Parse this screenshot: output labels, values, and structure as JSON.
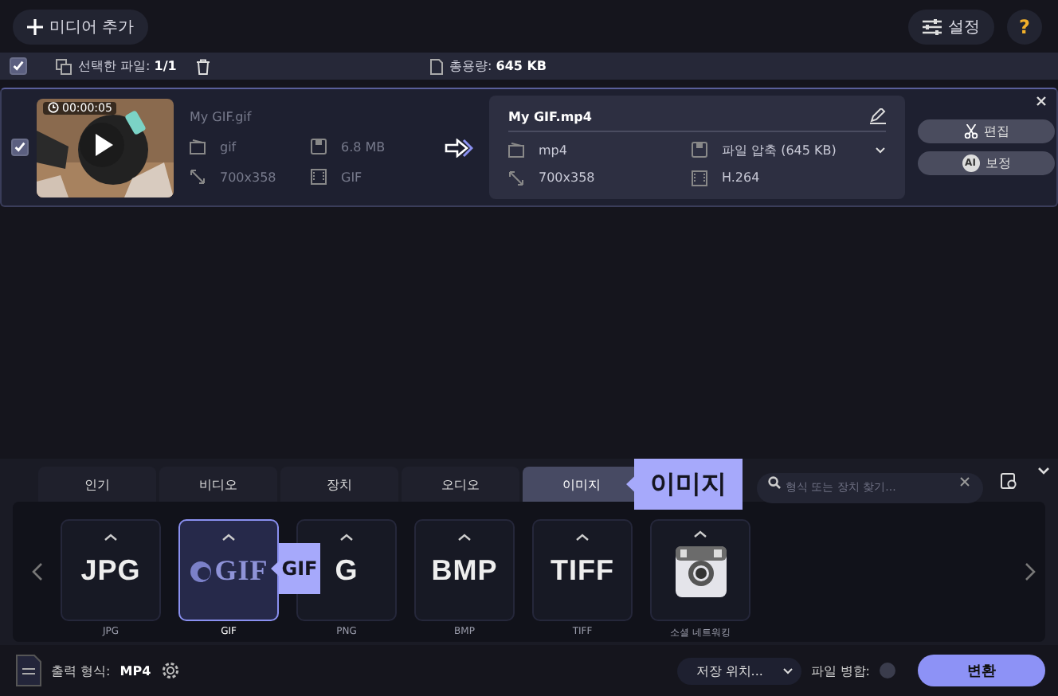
{
  "toolbar": {
    "add_media": "미디어 추가",
    "settings": "설정",
    "help": "?"
  },
  "selection_bar": {
    "checked": true,
    "selected_files_label": "선택한 파일:",
    "selected_files_count": "1/1",
    "total_size_label": "총용량:",
    "total_size": "645 KB"
  },
  "files": [
    {
      "checked": true,
      "duration": "00:00:05",
      "source": {
        "name": "My GIF.gif",
        "format": "gif",
        "size": "6.8 MB",
        "resolution": "700x358",
        "codec": "GIF"
      },
      "output": {
        "name": "My GIF.mp4",
        "format": "mp4",
        "compression": "파일 압축 (645 KB)",
        "resolution": "700x358",
        "codec": "H.264"
      },
      "edit_button": "편집",
      "enhance_badge": "AI",
      "enhance_button": "보정"
    }
  ],
  "format_tabs": [
    {
      "label": "인기",
      "selected": false
    },
    {
      "label": "비디오",
      "selected": false
    },
    {
      "label": "장치",
      "selected": false
    },
    {
      "label": "오디오",
      "selected": false
    },
    {
      "label": "이미지",
      "selected": true
    }
  ],
  "tab_tooltip": "이미지",
  "search": {
    "placeholder": "형식 또는 장치 찾기..."
  },
  "formats": [
    {
      "kind": "plain",
      "logo": "JPG",
      "label": "JPG",
      "selected": false
    },
    {
      "kind": "emblem",
      "logo": "GIF",
      "label": "GIF",
      "selected": true
    },
    {
      "kind": "plain",
      "logo": "G",
      "label": "PNG",
      "selected": false
    },
    {
      "kind": "plain",
      "logo": "BMP",
      "label": "BMP",
      "selected": false
    },
    {
      "kind": "plain",
      "logo": "TIFF",
      "label": "TIFF",
      "selected": false
    },
    {
      "kind": "camera",
      "label": "소셜 네트워킹",
      "selected": false
    }
  ],
  "format_tooltip": "GIF",
  "footer": {
    "output_format_label": "출력 형식:",
    "output_format": "MP4",
    "save_location": "저장 위치...",
    "merge_label": "파일 병합:",
    "merge_on": false,
    "convert": "변환"
  }
}
